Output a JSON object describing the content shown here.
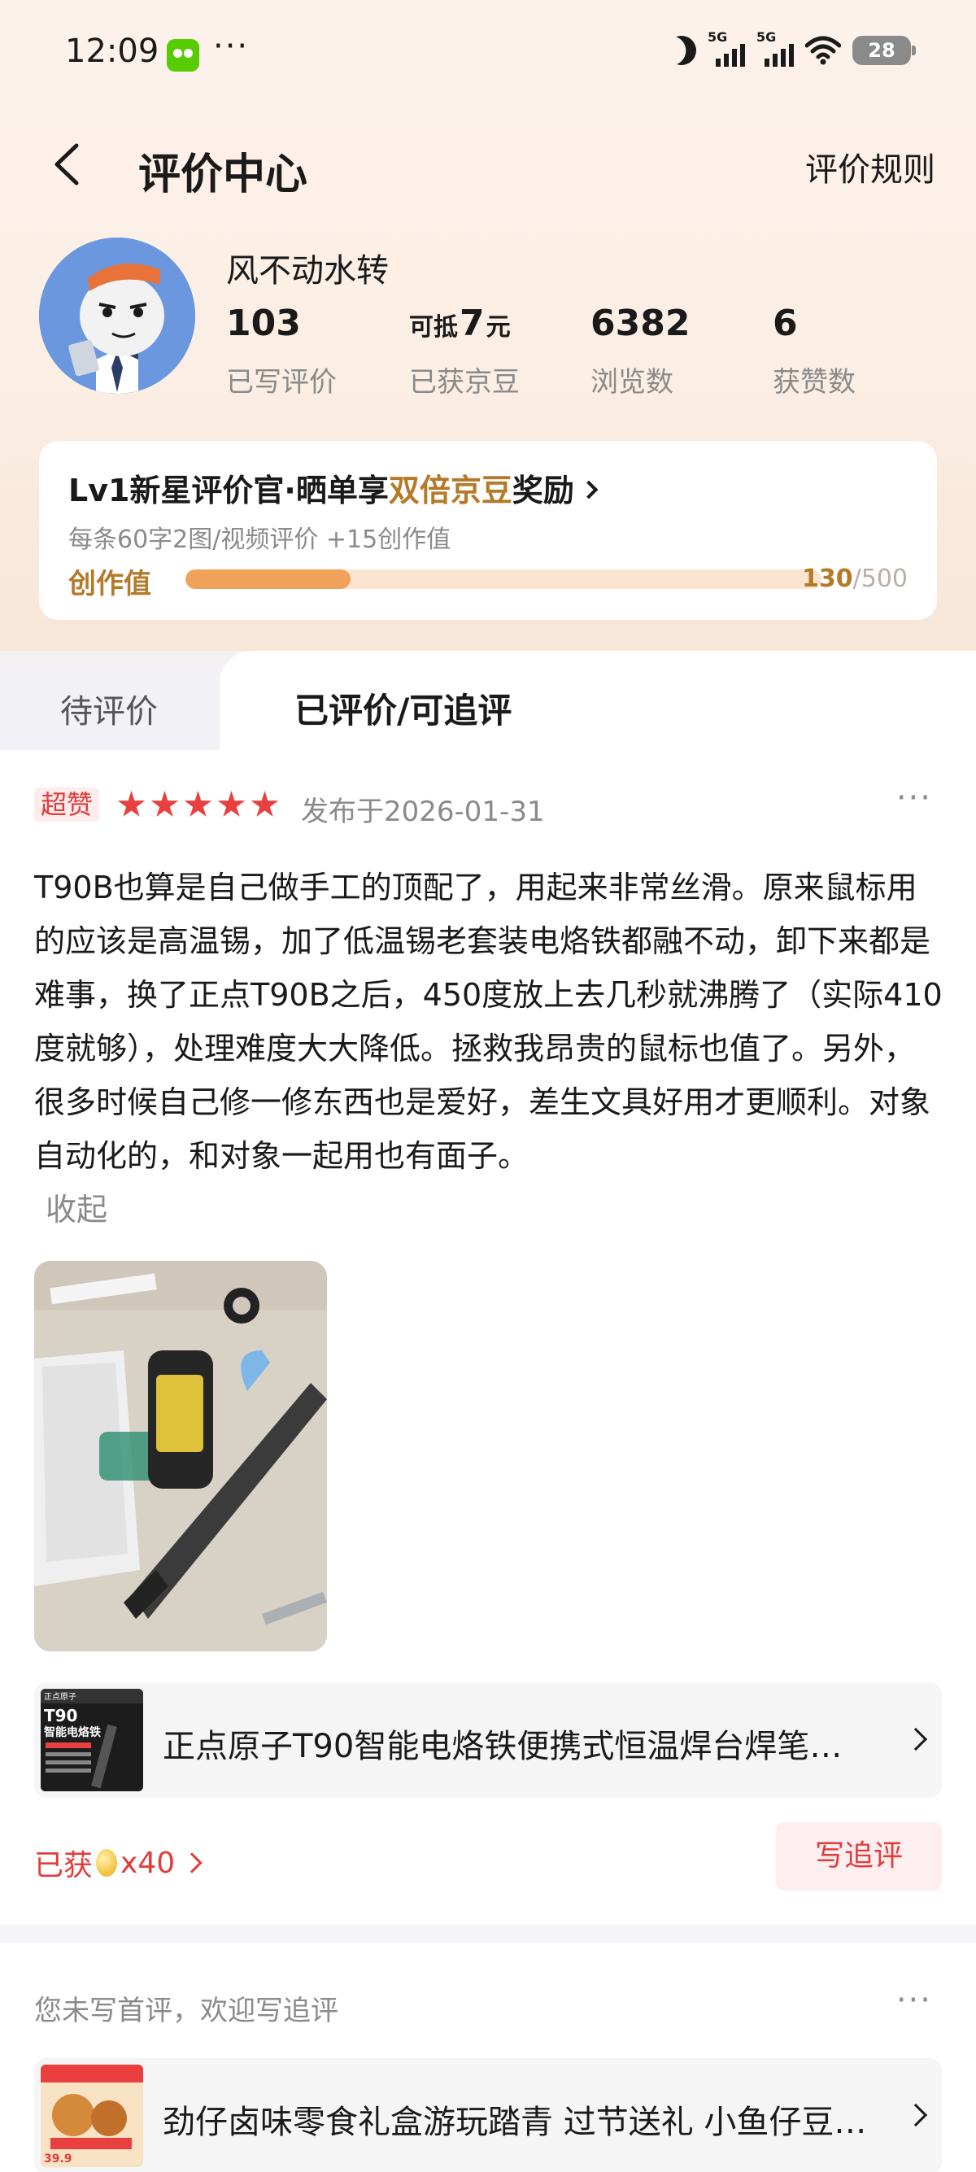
{
  "status_bar": {
    "time": "12:09",
    "more": "···",
    "network_1": "5G",
    "network_2": "5G",
    "battery": "28"
  },
  "nav": {
    "title": "评价中心",
    "rules_link": "评价规则"
  },
  "profile": {
    "username": "风不动水转",
    "stats": [
      {
        "prefix": "",
        "value": "103",
        "suffix": "",
        "label": "已写评价"
      },
      {
        "prefix": "可抵",
        "value": "7",
        "suffix": "元",
        "label": "已获京豆"
      },
      {
        "prefix": "",
        "value": "6382",
        "suffix": "",
        "label": "浏览数"
      },
      {
        "prefix": "",
        "value": "6",
        "suffix": "",
        "label": "获赞数"
      }
    ]
  },
  "level_card": {
    "title_pre": "Lv1新星评价官·晒单享",
    "title_highlight": "双倍京豆",
    "title_post": "奖励",
    "subtitle": "每条60字2图/视频评价 +15创作值",
    "progress_label": "创作值",
    "progress_current": "130",
    "progress_total": "/500",
    "progress_fraction": 0.26
  },
  "tabs": {
    "pending": "待评价",
    "done": "已评价/可追评"
  },
  "review": {
    "badge": "超赞",
    "rating": 5,
    "published": "发布于2026-01-31",
    "more": "···",
    "text": "T90B也算是自己做手工的顶配了，用起来非常丝滑。原来鼠标用的应该是高温锡，加了低温锡老套装电烙铁都融不动，卸下来都是难事，换了正点T90B之后，450度放上去几秒就沸腾了（实际410度就够），处理难度大大降低。拯救我昂贵的鼠标也值了。另外，很多时候自己修一修东西也是爱好，差生文具好用才更顺利。对象自动化的，和对象一起用也有面子。",
    "collapse": "收起",
    "product_name": "正点原子T90智能电烙铁便携式恒温焊台焊笔…",
    "product_thumb_brand": "正点原子",
    "product_thumb_model": "T90",
    "product_thumb_title": "智能电烙铁",
    "earned_pre": "已获",
    "earned_count": "x40",
    "follow_up_button": "写追评"
  },
  "second_review": {
    "hint": "您未写首评，欢迎写追评",
    "more": "···",
    "product_name": "劲仔卤味零食礼盒游玩踏青 过节送礼 小鱼仔豆…",
    "product_thumb_price": "39.9"
  },
  "colors": {
    "accent_red": "#e23c3c",
    "gold": "#b47a2a",
    "progress_fill": "#f0a25a"
  }
}
